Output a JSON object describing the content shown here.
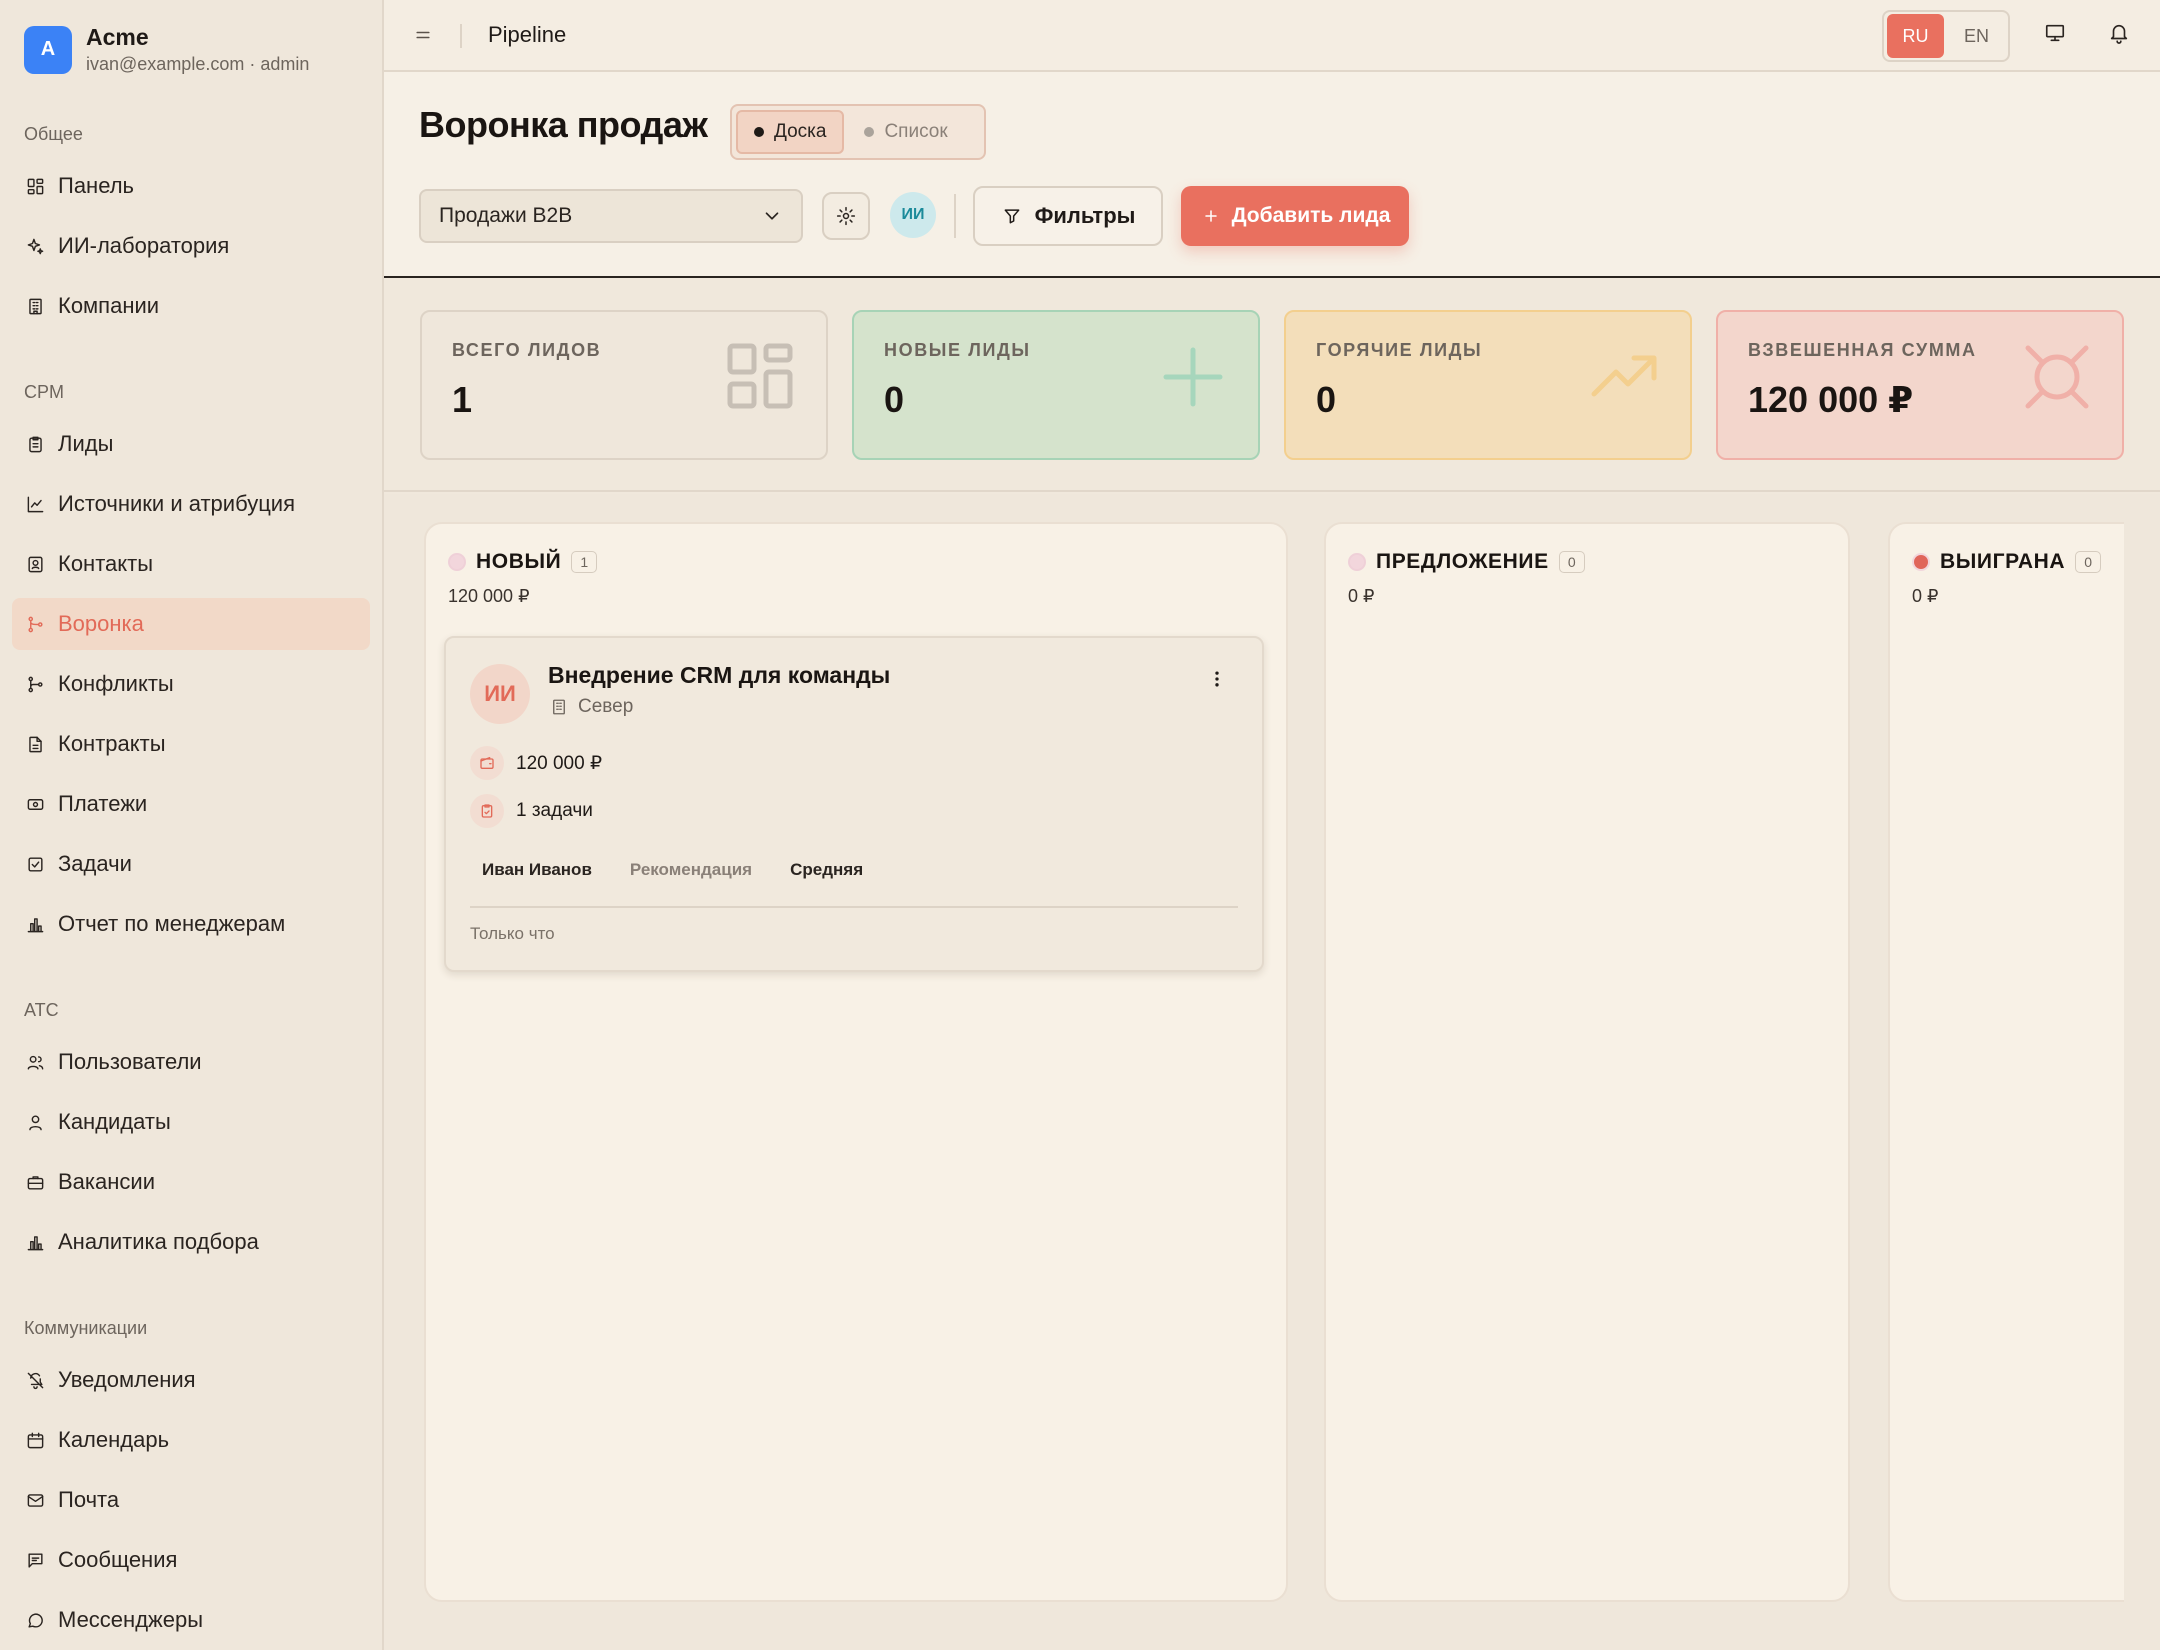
{
  "brand": {
    "initial": "A",
    "name": "Acme",
    "sub": "ivan@example.com · admin"
  },
  "sidebar": {
    "sections": [
      {
        "label": "Общее",
        "items": [
          {
            "label": "Панель",
            "icon": "dashboard-icon"
          },
          {
            "label": "ИИ-лаборатория",
            "icon": "sparkles-icon"
          },
          {
            "label": "Компании",
            "icon": "building-icon"
          }
        ]
      },
      {
        "label": "CPM",
        "items": [
          {
            "label": "Лиды",
            "icon": "clipboard-icon"
          },
          {
            "label": "Источники и атрибуция",
            "icon": "chart-line-icon"
          },
          {
            "label": "Контакты",
            "icon": "contact-book-icon"
          },
          {
            "label": "Воронка",
            "icon": "git-merge-icon",
            "active": true
          },
          {
            "label": "Конфликты",
            "icon": "git-branch-icon"
          },
          {
            "label": "Контракты",
            "icon": "file-text-icon"
          },
          {
            "label": "Платежи",
            "icon": "banknote-icon"
          },
          {
            "label": "Задачи",
            "icon": "check-square-icon"
          },
          {
            "label": "Отчет по менеджерам",
            "icon": "bar-chart-icon"
          }
        ]
      },
      {
        "label": "ATC",
        "items": [
          {
            "label": "Пользователи",
            "icon": "users-icon"
          },
          {
            "label": "Кандидаты",
            "icon": "user-icon"
          },
          {
            "label": "Вакансии",
            "icon": "briefcase-icon"
          },
          {
            "label": "Аналитика подбора",
            "icon": "bar-chart-icon"
          }
        ]
      },
      {
        "label": "Коммуникации",
        "items": [
          {
            "label": "Уведомления",
            "icon": "bell-off-icon"
          },
          {
            "label": "Календарь",
            "icon": "calendar-icon"
          },
          {
            "label": "Почта",
            "icon": "mail-icon"
          },
          {
            "label": "Сообщения",
            "icon": "message-square-icon"
          },
          {
            "label": "Мессенджеры",
            "icon": "message-circle-icon"
          }
        ]
      }
    ]
  },
  "topbar": {
    "title": "Pipeline",
    "lang": [
      "RU",
      "EN"
    ],
    "lang_active": "RU"
  },
  "header": {
    "title": "Воронка продаж",
    "views": [
      "Доска",
      "Список"
    ],
    "view_active": "Доска",
    "pipeline_select": "Продажи B2B",
    "ai_badge": "ИИ",
    "filters_label": "Фильтры",
    "add_label": "Добавить лида"
  },
  "stats": [
    {
      "label": "ВСЕГО ЛИДОВ",
      "value": "1",
      "icon": "layout-grid-icon",
      "color": "#c7bfb5"
    },
    {
      "label": "НОВЫЕ ЛИДЫ",
      "value": "0",
      "icon": "plus-icon",
      "color": "#a6d6bc"
    },
    {
      "label": "ГОРЯЧИЕ ЛИДЫ",
      "value": "0",
      "icon": "trending-up-icon",
      "color": "#f3cf8e"
    },
    {
      "label": "ВЗВЕШЕННАЯ СУММА",
      "value": "120 000 ₽",
      "icon": "currency-icon",
      "color": "#f0b0a8"
    }
  ],
  "columns": [
    {
      "title": "НОВЫЙ",
      "count": "1",
      "sum": "120 000 ₽",
      "dot": "#f2d6dc"
    },
    {
      "title": "ПРЕДЛОЖЕНИЕ",
      "count": "0",
      "sum": "0 ₽",
      "dot": "#f2d6dc"
    },
    {
      "title": "ВЫИГРАНА",
      "count": "0",
      "sum": "0 ₽",
      "dot": "#e0655a"
    }
  ],
  "card": {
    "avatar": "ИИ",
    "title": "Внедрение CRM для команды",
    "company": "Север",
    "amount": "120 000 ₽",
    "tasks": "1 задачи",
    "tags": [
      "Иван Иванов",
      "Рекомендация",
      "Средняя"
    ],
    "time": "Только что"
  },
  "colors": {
    "accent": "#e9705f",
    "bg": "#f0e8dc"
  }
}
